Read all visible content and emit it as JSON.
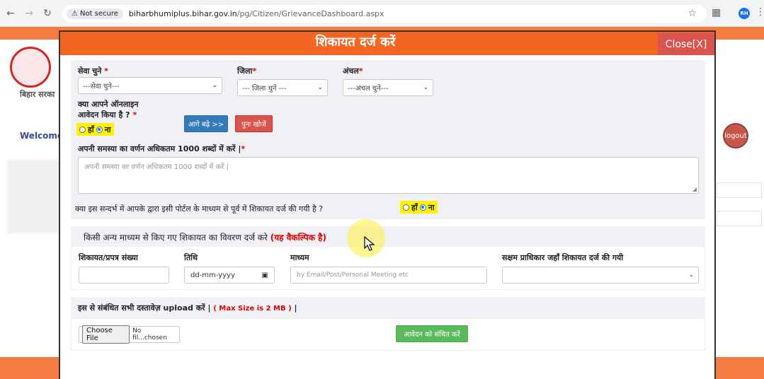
{
  "browser": {
    "not_secure": "Not secure",
    "url_host": "biharbhumiplus.bihar.gov.in",
    "url_path": "/pg/Citizen/GrievanceDashboard.aspx",
    "profile_initials": "RH"
  },
  "background": {
    "logo_caption": "बिहार सरका",
    "welcome": "Welcome",
    "logout": "logout"
  },
  "modal": {
    "title": "शिकायत दर्ज करें",
    "close_label": "Close[X]",
    "service": {
      "label": "सेवा चुने",
      "required": "*",
      "value": "---सेवा चुने---"
    },
    "district": {
      "label": "जिला",
      "required": "*",
      "value": "--- जिला चुनें ---"
    },
    "circle": {
      "label": "अंचल",
      "required": "*",
      "value": "---अंचल चुनें---"
    },
    "online_question": {
      "line1": "क्या आपने ऑनलाइन",
      "line2": "आवेदन किया है ?",
      "required": "*",
      "yes": "हाँ",
      "no": "ना"
    },
    "next_button": "आगे बढ़े >>",
    "search_again_button": "पुनः खोजें",
    "description": {
      "label": "अपनी समस्या का वर्णन अधिकतम 1000 शब्दों में करें |",
      "required": "*",
      "placeholder": "अपनी समस्या का वर्णन अधिकतम 1000 शब्दों में करें |"
    },
    "prior_complaint": {
      "question": "क्या इस सन्दर्भ में आपके द्वारा इसी पोर्टल के माध्यम से पूर्व में शिकायत दर्ज की गयी है ?",
      "yes": "हाँ",
      "no": "ना"
    },
    "other_medium": {
      "heading": "किसी अन्य माध्यम से किए गए शिकायत का विवरण दर्ज करे",
      "optional": "(यह वैकल्पिक है)",
      "complaint_no_label": "शिकायत/प्रपत्र संख्या",
      "date_label": "तिथि",
      "date_placeholder": "dd-mm-yyyy",
      "medium_label": "माध्यम",
      "medium_placeholder": "by Email/Post/Personal Meeting etc",
      "authority_label": "सक्षम प्राधिकार जहाँ शिकायत दर्ज की गयी"
    },
    "documents": {
      "heading": "इस से संबंधित सभी दस्तावेज़ upload करें |",
      "max_size": "( Max Size is 2 MB )",
      "separator": "|",
      "choose_file": "Choose File",
      "no_file": "No fil...chosen",
      "submit_button": "आवेदन को संचित करें"
    }
  },
  "colors": {
    "orange_brand": "#f26522",
    "close_red": "#d9534f",
    "highlight_yellow": "#fff200",
    "button_blue": "#337ab7",
    "button_green": "#5cb85c"
  }
}
